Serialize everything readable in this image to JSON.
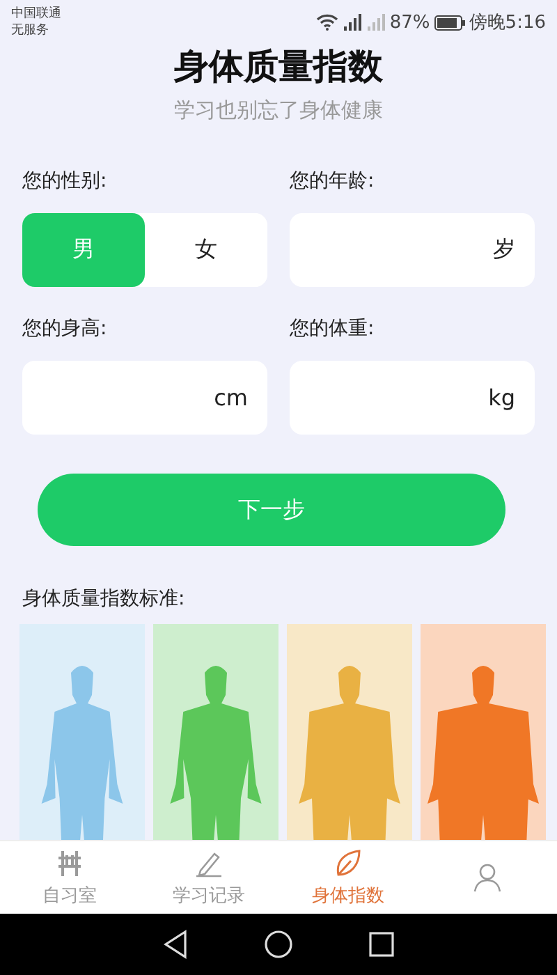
{
  "status_bar": {
    "carrier": "中国联通",
    "service": "无服务",
    "battery": "87%",
    "time": "傍晚5:16"
  },
  "header": {
    "title": "身体质量指数",
    "subtitle": "学习也别忘了身体健康"
  },
  "form": {
    "gender_label": "您的性别:",
    "genders": [
      {
        "label": "男",
        "selected": true
      },
      {
        "label": "女",
        "selected": false
      }
    ],
    "age_label": "您的年龄:",
    "age_unit": "岁",
    "height_label": "您的身高:",
    "height_unit": "cm",
    "weight_label": "您的体重:",
    "weight_unit": "kg",
    "next_button": "下一步"
  },
  "standard": {
    "label": "身体质量指数标准:",
    "figures": [
      {
        "kind": "slim",
        "color": "#8cc6ea"
      },
      {
        "kind": "normal",
        "color": "#5cc75a"
      },
      {
        "kind": "heavy",
        "color": "#e9b143"
      },
      {
        "kind": "obese",
        "color": "#f07726"
      }
    ]
  },
  "tabs": [
    {
      "kind": "room",
      "label": "自习室",
      "selected": false
    },
    {
      "kind": "record",
      "label": "学习记录",
      "selected": false
    },
    {
      "kind": "leaf",
      "label": "身体指数",
      "selected": true
    },
    {
      "kind": "person",
      "selected": false
    }
  ]
}
